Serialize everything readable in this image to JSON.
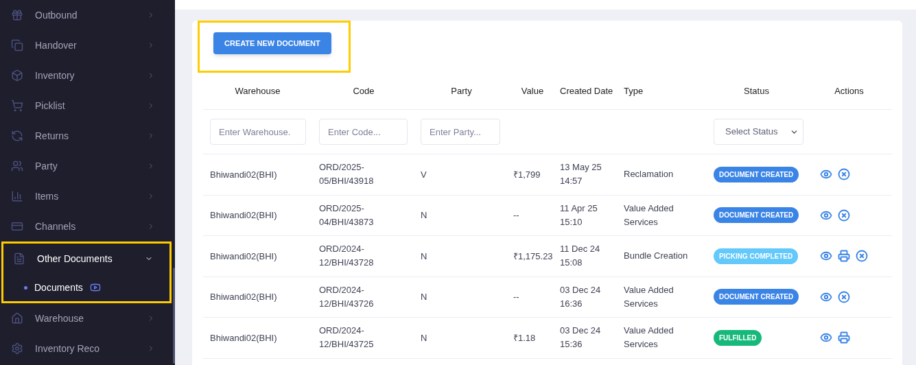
{
  "sidebar": {
    "items": [
      {
        "label": "Outbound",
        "expanded": false,
        "highlighted": false
      },
      {
        "label": "Handover",
        "expanded": false,
        "highlighted": false
      },
      {
        "label": "Inventory",
        "expanded": false,
        "highlighted": false
      },
      {
        "label": "Picklist",
        "expanded": false,
        "highlighted": false
      },
      {
        "label": "Returns",
        "expanded": false,
        "highlighted": false
      },
      {
        "label": "Party",
        "expanded": false,
        "highlighted": false
      },
      {
        "label": "Items",
        "expanded": false,
        "highlighted": false
      },
      {
        "label": "Channels",
        "expanded": false,
        "highlighted": false
      },
      {
        "label": "Other Documents",
        "expanded": true,
        "highlighted": true,
        "children": [
          {
            "label": "Documents",
            "selected": true
          }
        ]
      },
      {
        "label": "Warehouse",
        "expanded": false,
        "highlighted": false
      },
      {
        "label": "Inventory Reco",
        "expanded": false,
        "highlighted": false
      }
    ]
  },
  "create_button": {
    "label": "CREATE NEW DOCUMENT",
    "highlighted": true
  },
  "table": {
    "columns": [
      "Warehouse",
      "Code",
      "Party",
      "Value",
      "Created Date",
      "Type",
      "Status",
      "Actions"
    ],
    "filters": {
      "warehouse": {
        "placeholder": "Enter Warehouse."
      },
      "code": {
        "placeholder": "Enter Code..."
      },
      "party": {
        "placeholder": "Enter Party..."
      },
      "status": {
        "placeholder": "Select Status"
      }
    },
    "rows": [
      {
        "warehouse": "Bhiwandi02(BHI)",
        "code": "ORD/2025-05/BHI/43918",
        "party": "V",
        "value": "₹1,799",
        "date": "13 May 25",
        "time": "14:57",
        "type": "Reclamation",
        "status": {
          "label": "DOCUMENT CREATED",
          "color": "#3a84e6"
        },
        "actions": [
          {
            "kind": "view"
          },
          {
            "kind": "cancel"
          }
        ]
      },
      {
        "warehouse": "Bhiwandi02(BHI)",
        "code": "ORD/2025-04/BHI/43873",
        "party": "N",
        "value": "--",
        "date": "11 Apr 25",
        "time": "15:10",
        "type": "Value Added Services",
        "status": {
          "label": "DOCUMENT CREATED",
          "color": "#3a84e6"
        },
        "actions": [
          {
            "kind": "view"
          },
          {
            "kind": "cancel"
          }
        ]
      },
      {
        "warehouse": "Bhiwandi02(BHI)",
        "code": "ORD/2024-12/BHI/43728",
        "party": "N",
        "value": "₹1,175.23",
        "date": "11 Dec 24",
        "time": "15:08",
        "type": "Bundle Creation",
        "status": {
          "label": "PICKING COMPLETED",
          "color": "#63c8fa"
        },
        "actions": [
          {
            "kind": "view"
          },
          {
            "kind": "print"
          },
          {
            "kind": "cancel"
          }
        ]
      },
      {
        "warehouse": "Bhiwandi02(BHI)",
        "code": "ORD/2024-12/BHI/43726",
        "party": "N",
        "value": "--",
        "date": "03 Dec 24",
        "time": "16:36",
        "type": "Value Added Services",
        "status": {
          "label": "DOCUMENT CREATED",
          "color": "#3a84e6"
        },
        "actions": [
          {
            "kind": "view"
          },
          {
            "kind": "cancel"
          }
        ]
      },
      {
        "warehouse": "Bhiwandi02(BHI)",
        "code": "ORD/2024-12/BHI/43725",
        "party": "N",
        "value": "₹1.18",
        "date": "03 Dec 24",
        "time": "15:36",
        "type": "Value Added Services",
        "status": {
          "label": "FULFILLED",
          "color": "#16b97a"
        },
        "actions": [
          {
            "kind": "view"
          },
          {
            "kind": "print"
          }
        ]
      }
    ]
  }
}
